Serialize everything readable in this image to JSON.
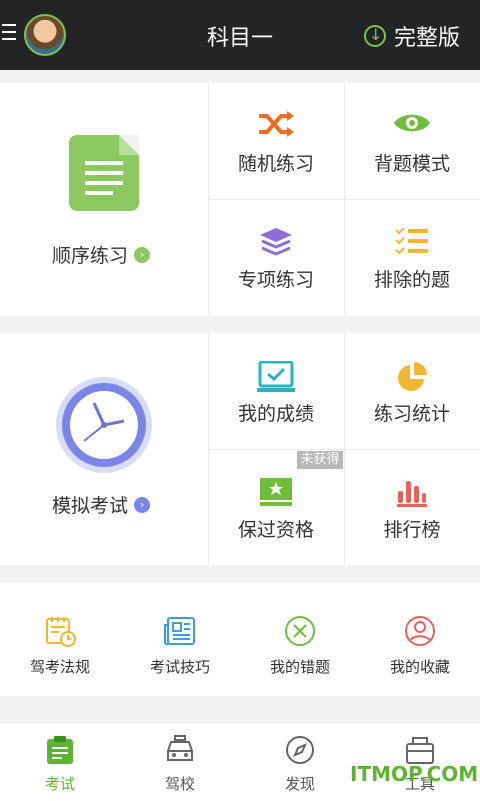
{
  "header": {
    "title": "科目一",
    "full_version": "完整版"
  },
  "section1": {
    "big": {
      "label": "顺序练习"
    },
    "cells": [
      "随机练习",
      "背题模式",
      "专项练习",
      "排除的题"
    ]
  },
  "section2": {
    "big": {
      "label": "模拟考试"
    },
    "cells": [
      "我的成绩",
      "练习统计",
      "保过资格",
      "排行榜"
    ],
    "badge": "未获得"
  },
  "tools": [
    "驾考法规",
    "考试技巧",
    "我的错题",
    "我的收藏"
  ],
  "tabs": [
    "考试",
    "驾校",
    "发现",
    "工具"
  ],
  "watermark": "ITMOP.COM",
  "colors": {
    "accent": "#5cb531",
    "orange": "#f26b1d",
    "purple": "#8b6fd6",
    "yellow": "#f5b52e",
    "red": "#e8625a",
    "teal": "#2bb3c0"
  }
}
